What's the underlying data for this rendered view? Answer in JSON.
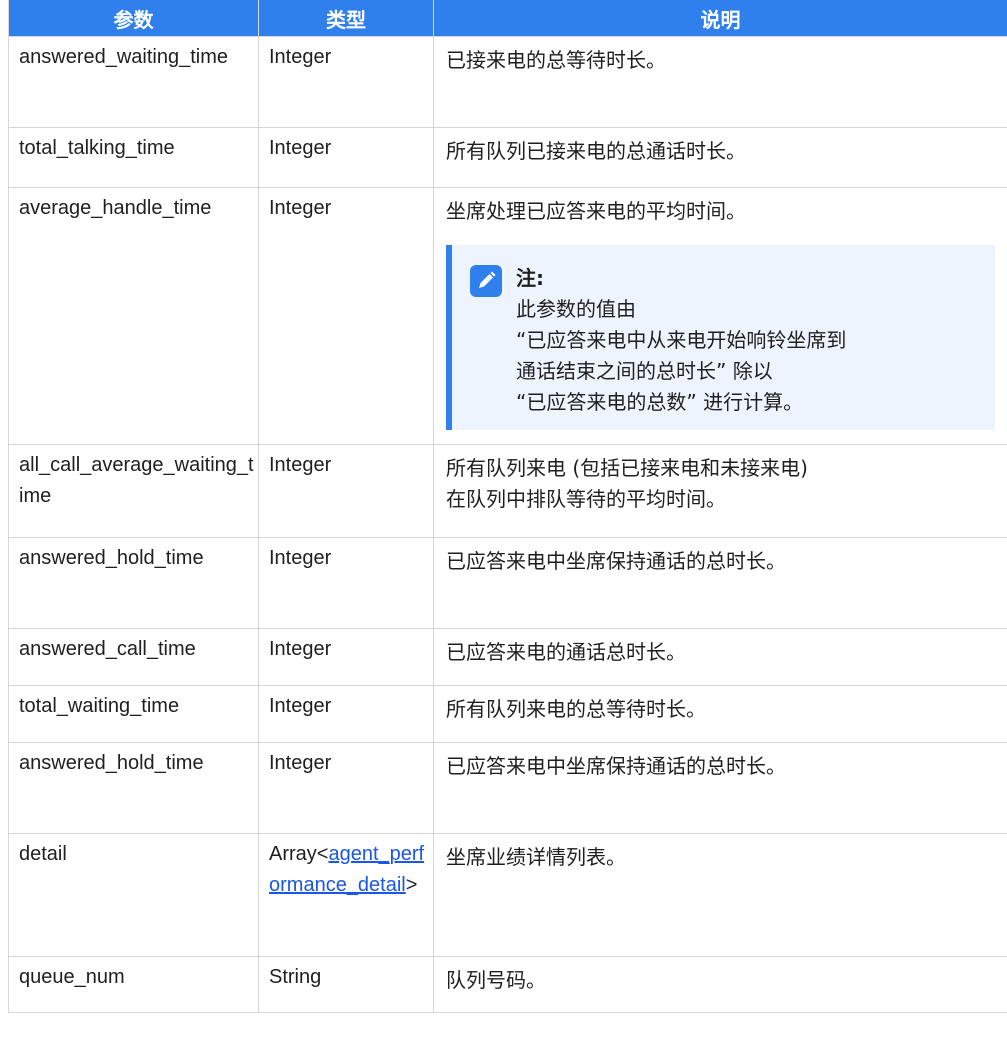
{
  "header": {
    "col_param": "参数",
    "col_type": "类型",
    "col_desc": "说明"
  },
  "rows": [
    {
      "name": "answered_waiting_time",
      "type": "Integer",
      "desc": "已接来电的总等待时长。"
    },
    {
      "name": "total_talking_time",
      "type": "Integer",
      "desc": "所有队列已接来电的总通话时长。"
    },
    {
      "name": "average_handle_time",
      "type": "Integer",
      "desc": "坐席处理已应答来电的平均时间。"
    },
    {
      "name": "all_call_average_waiting_time",
      "type": "Integer",
      "desc_line1": "所有队列来电 (包括已接来电和未接来电)",
      "desc_line2": "在队列中排队等待的平均时间。"
    },
    {
      "name": "answered_hold_time",
      "type": "Integer",
      "desc": "已应答来电中坐席保持通话的总时长。"
    },
    {
      "name": "answered_call_time",
      "type": "Integer",
      "desc": "已应答来电的通话总时长。"
    },
    {
      "name": "total_waiting_time",
      "type": "Integer",
      "desc": "所有队列来电的总等待时长。"
    },
    {
      "name": "answered_hold_time",
      "type": "Integer",
      "desc": "已应答来电中坐席保持通话的总时长。"
    },
    {
      "name": "detail",
      "type_prefix": "Array<",
      "type_link": "agent_performance_detail",
      "type_suffix": ">",
      "desc": "坐席业绩详情列表。"
    },
    {
      "name": "queue_num",
      "type": "String",
      "desc": "队列号码。"
    }
  ],
  "note": {
    "title": "注:",
    "line1": "此参数的值由",
    "line2": "“已应答来电中从来电开始响铃坐席到",
    "line3": "通话结束之间的总时长” 除以",
    "line4": "“已应答来电的总数” 进行计算。",
    "icon": "edit-pencil-icon",
    "accent_color": "#2f80ed",
    "bg_color": "#eef4fd"
  },
  "colors": {
    "header_bg": "#2f80ed",
    "link": "#1a56e8"
  }
}
